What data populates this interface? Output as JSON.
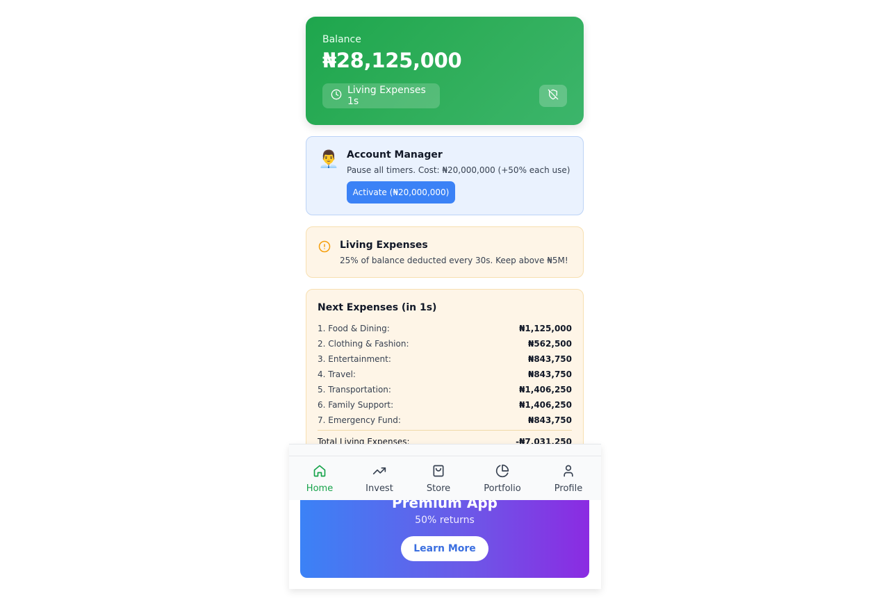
{
  "balance": {
    "label": "Balance",
    "amount": "₦28,125,000",
    "timer_chip": "Living Expenses 1s"
  },
  "account_manager": {
    "emoji": "👨‍💼",
    "title": "Account Manager",
    "description": "Pause all timers. Cost: ₦20,000,000 (+50% each use)",
    "button": "Activate (₦20,000,000)"
  },
  "living_expenses": {
    "title": "Living Expenses",
    "description": "25% of balance deducted every 30s. Keep above ₦5M!"
  },
  "next_expenses": {
    "title": "Next Expenses (in 1s)",
    "items": [
      {
        "label": "1. Food & Dining:",
        "value": "₦1,125,000"
      },
      {
        "label": "2. Clothing & Fashion:",
        "value": "₦562,500"
      },
      {
        "label": "3. Entertainment:",
        "value": "₦843,750"
      },
      {
        "label": "4. Travel:",
        "value": "₦843,750"
      },
      {
        "label": "5. Transportation:",
        "value": "₦1,406,250"
      },
      {
        "label": "6. Family Support:",
        "value": "₦1,406,250"
      },
      {
        "label": "7. Emergency Fund:",
        "value": "₦843,750"
      }
    ],
    "total_label": "Total Living Expenses:",
    "total_value": "-₦7,031,250"
  },
  "promo": {
    "title": "Premium App",
    "subtitle": "50% returns",
    "button": "Learn More"
  },
  "nav": {
    "items": [
      {
        "label": "Home",
        "icon": "home-icon",
        "active": true
      },
      {
        "label": "Invest",
        "icon": "trending-up-icon",
        "active": false
      },
      {
        "label": "Store",
        "icon": "shopping-bag-icon",
        "active": false
      },
      {
        "label": "Portfolio",
        "icon": "pie-chart-icon",
        "active": false
      },
      {
        "label": "Profile",
        "icon": "user-icon",
        "active": false
      }
    ]
  },
  "colors": {
    "primary_green": "#16a34a",
    "blue": "#3b82f6",
    "warning": "#f59e0b"
  }
}
